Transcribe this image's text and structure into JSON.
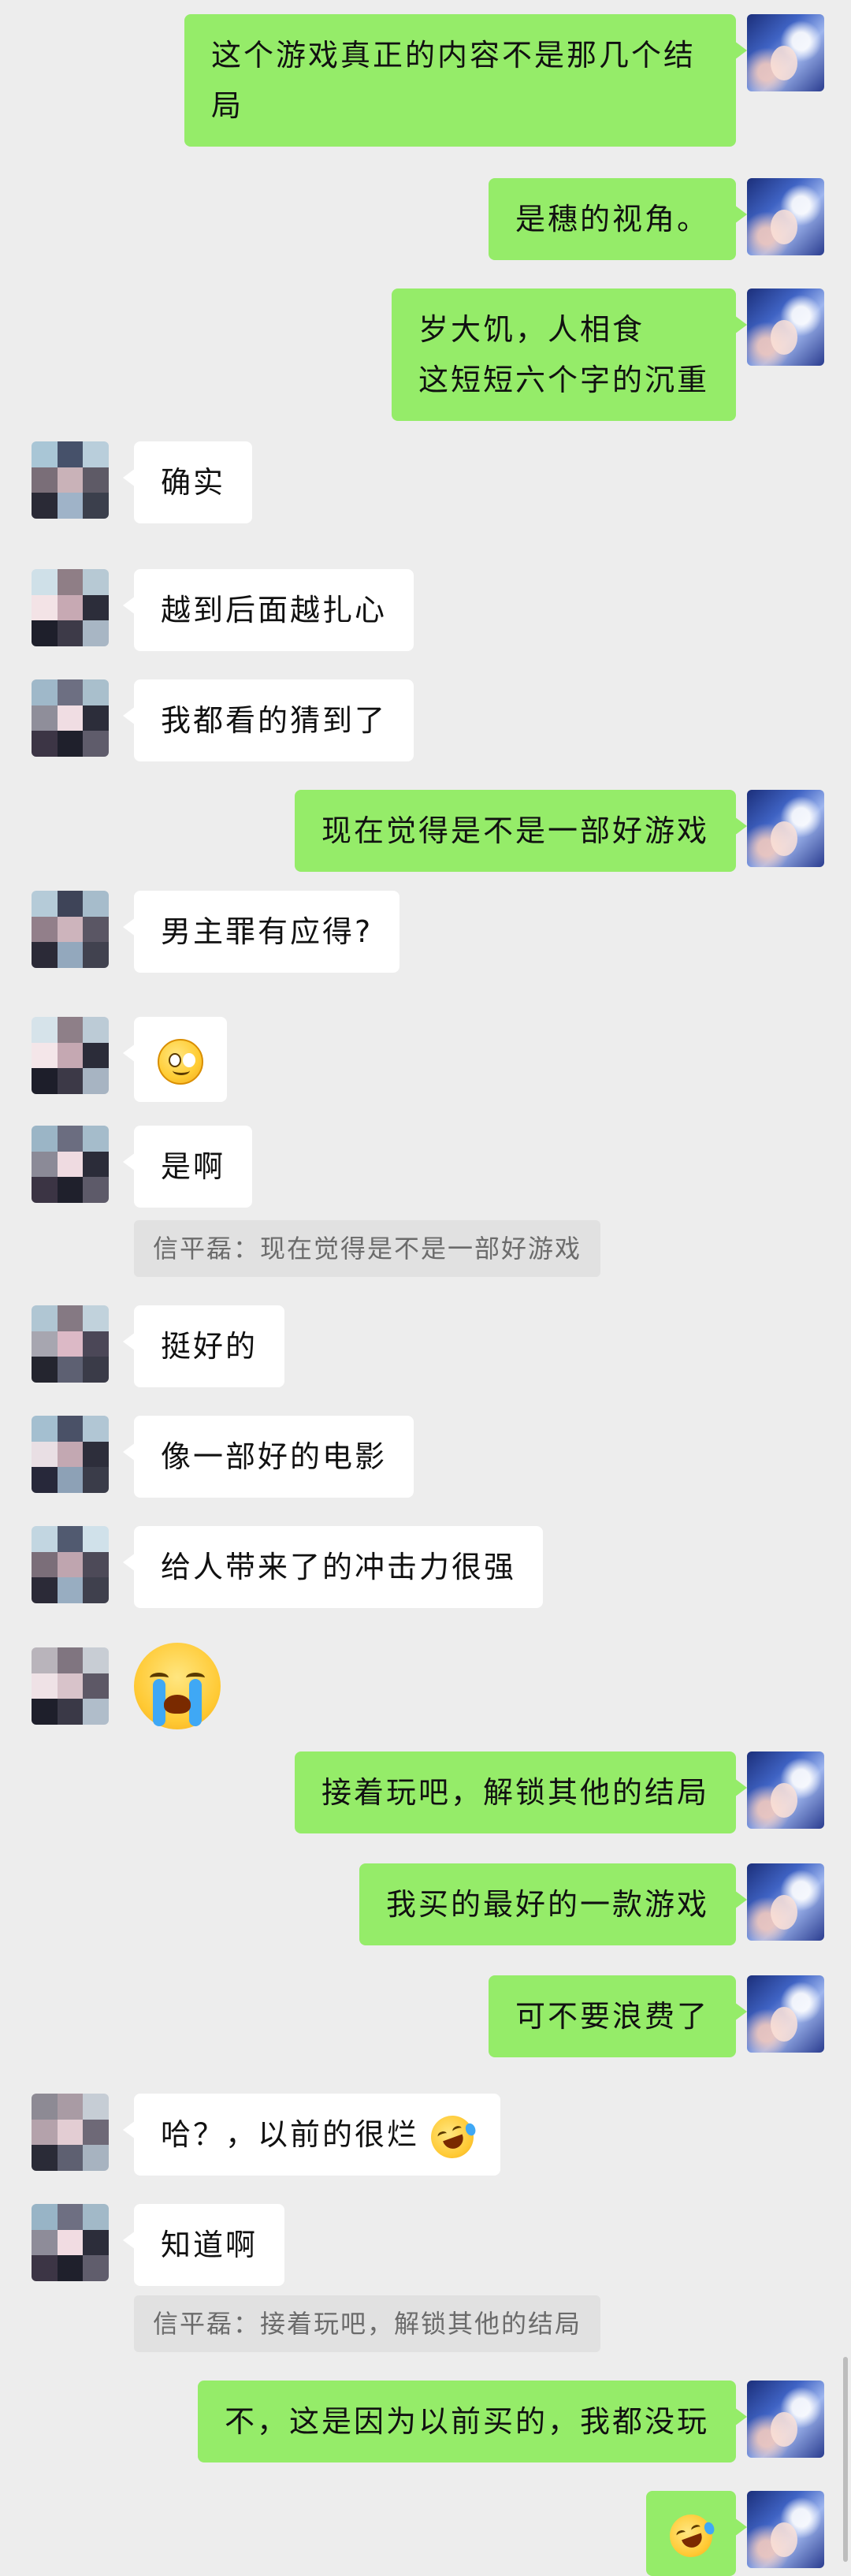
{
  "conversation": {
    "quoted_sender": "信平磊",
    "messages": [
      {
        "side": "right",
        "text": "这个游戏真正的内容不是那几个结局"
      },
      {
        "side": "right",
        "text": "是穗的视角。"
      },
      {
        "side": "right",
        "line1": "岁大饥，人相食",
        "line2": "这短短六个字的沉重"
      },
      {
        "side": "left",
        "text": "确实"
      },
      {
        "side": "left",
        "text": "越到后面越扎心"
      },
      {
        "side": "left",
        "text": "我都看的猜到了"
      },
      {
        "side": "right",
        "text": "现在觉得是不是一部好游戏"
      },
      {
        "side": "left",
        "text": "男主罪有应得?"
      },
      {
        "side": "left",
        "emoji": "smile-emoji"
      },
      {
        "side": "left",
        "text": "是啊"
      },
      {
        "quote": "信平磊：现在觉得是不是一部好游戏"
      },
      {
        "side": "left",
        "text": "挺好的"
      },
      {
        "side": "left",
        "text": "像一部好的电影"
      },
      {
        "side": "left",
        "text": "给人带来了的冲击力很强"
      },
      {
        "side": "left",
        "emoji": "crying-emoji"
      },
      {
        "side": "right",
        "text": "接着玩吧，解锁其他的结局"
      },
      {
        "side": "right",
        "text": "我买的最好的一款游戏"
      },
      {
        "side": "right",
        "text": "可不要浪费了"
      },
      {
        "side": "left",
        "text": "哈？，以前的很烂",
        "emoji": "laugh-cry-emoji"
      },
      {
        "side": "left",
        "text": "知道啊"
      },
      {
        "quote": "信平磊：接着玩吧，解锁其他的结局"
      },
      {
        "side": "right",
        "text": "不，这是因为以前买的，我都没玩"
      },
      {
        "side": "right",
        "emoji": "laugh-cry-emoji"
      }
    ]
  },
  "colors": {
    "background": "#ededed",
    "own_bubble": "#95ec69",
    "other_bubble": "#ffffff",
    "quote_bg": "#e1e1e1"
  }
}
